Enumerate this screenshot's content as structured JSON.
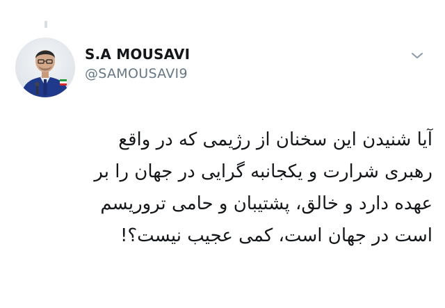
{
  "tweet": {
    "author": {
      "display_name": "S.A MOUSAVI",
      "handle": "@SAMOUSAVI9",
      "avatar_icon": "profile-photo"
    },
    "menu_icon": "chevron-down-icon",
    "text_lines": [
      "آیا شنیدن این سخنان از رژیمی که در واقع",
      "رهبری شرارت و یکجانبه گرایی در جهان را بر",
      "عهده دارد و خالق، پشتیبان و حامی تروریسم",
      "است در جهان است، کمی عجیب نیست؟!"
    ]
  },
  "colors": {
    "text": "#14171a",
    "secondary": "#657786",
    "background": "#ffffff"
  }
}
